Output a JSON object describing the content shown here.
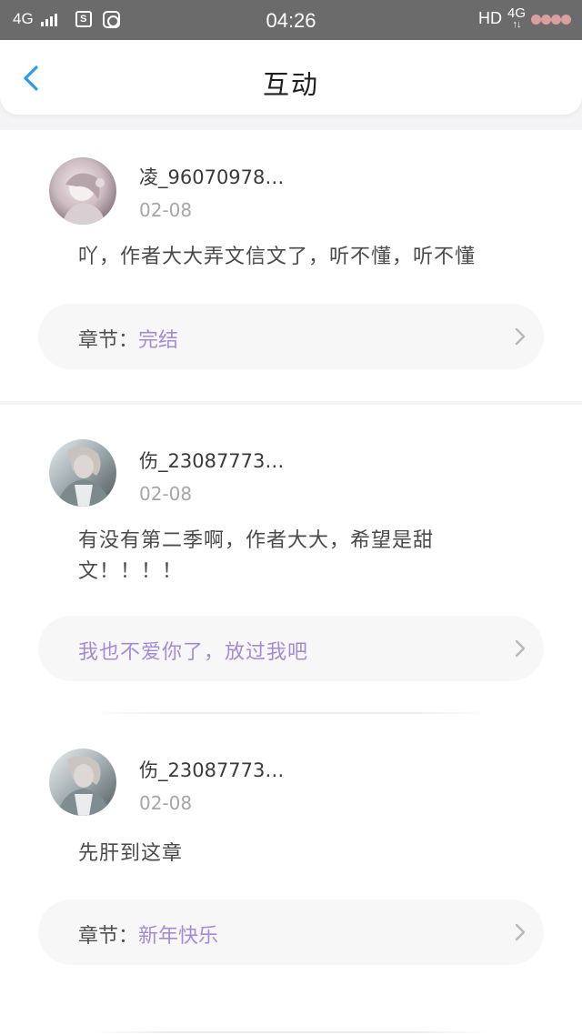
{
  "status_bar": {
    "network_left": "4G",
    "sim_icon_text": "S",
    "time": "04:26",
    "hd": "HD",
    "network_right": "4G",
    "arrows": "↑↓"
  },
  "header": {
    "title": "互动"
  },
  "comments": [
    {
      "username": "凌_96070978…",
      "date": "02-08",
      "text": "吖，作者大大弄文信文了，听不懂，听不懂",
      "link_label": "章节：",
      "link_value": "完结"
    },
    {
      "username": "伤_23087773…",
      "date": "02-08",
      "text": "有没有第二季啊，作者大大，希望是甜文！！！！",
      "link_text": "我也不爱你了，放过我吧"
    },
    {
      "username": "伤_23087773…",
      "date": "02-08",
      "text": "先肝到这章",
      "link_label": "章节：",
      "link_value": "新年快乐"
    }
  ],
  "colors": {
    "accent_blue": "#2b9af3",
    "link_purple": "#a58bd6",
    "status_bar": "#6b6b6b"
  }
}
